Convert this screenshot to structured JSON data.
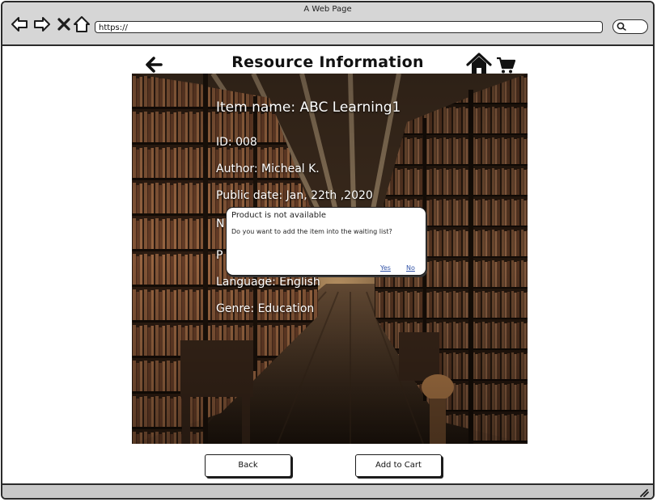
{
  "window": {
    "title": "A Web Page",
    "url": "https://"
  },
  "page": {
    "title": "Resource Information"
  },
  "item": {
    "name": "Item name: ABC Learning1",
    "id": "ID: 008",
    "author": "Author: Micheal K.",
    "public_date": "Public date: Jan, 22th ,2020",
    "hidden_line1_initial": "N",
    "hidden_line2_initial": "P",
    "language": "Language: English",
    "genre": "Genre: Education"
  },
  "dialog": {
    "title": "Product is not available",
    "message": "Do you want to add the item into the waiting list?",
    "yes_label": "Yes",
    "no_label": "No"
  },
  "buttons": {
    "back_label": "Back",
    "add_to_cart_label": "Add to Cart"
  },
  "icons": {
    "nav_back": "arrow-left-outline-icon",
    "nav_forward": "arrow-right-outline-icon",
    "close": "close-x-icon",
    "home": "home-outline-icon",
    "page_back": "arrow-left-icon",
    "page_home": "home-icon",
    "cart": "shopping-cart-icon",
    "search": "search-icon",
    "resize": "resize-grip-icon"
  }
}
